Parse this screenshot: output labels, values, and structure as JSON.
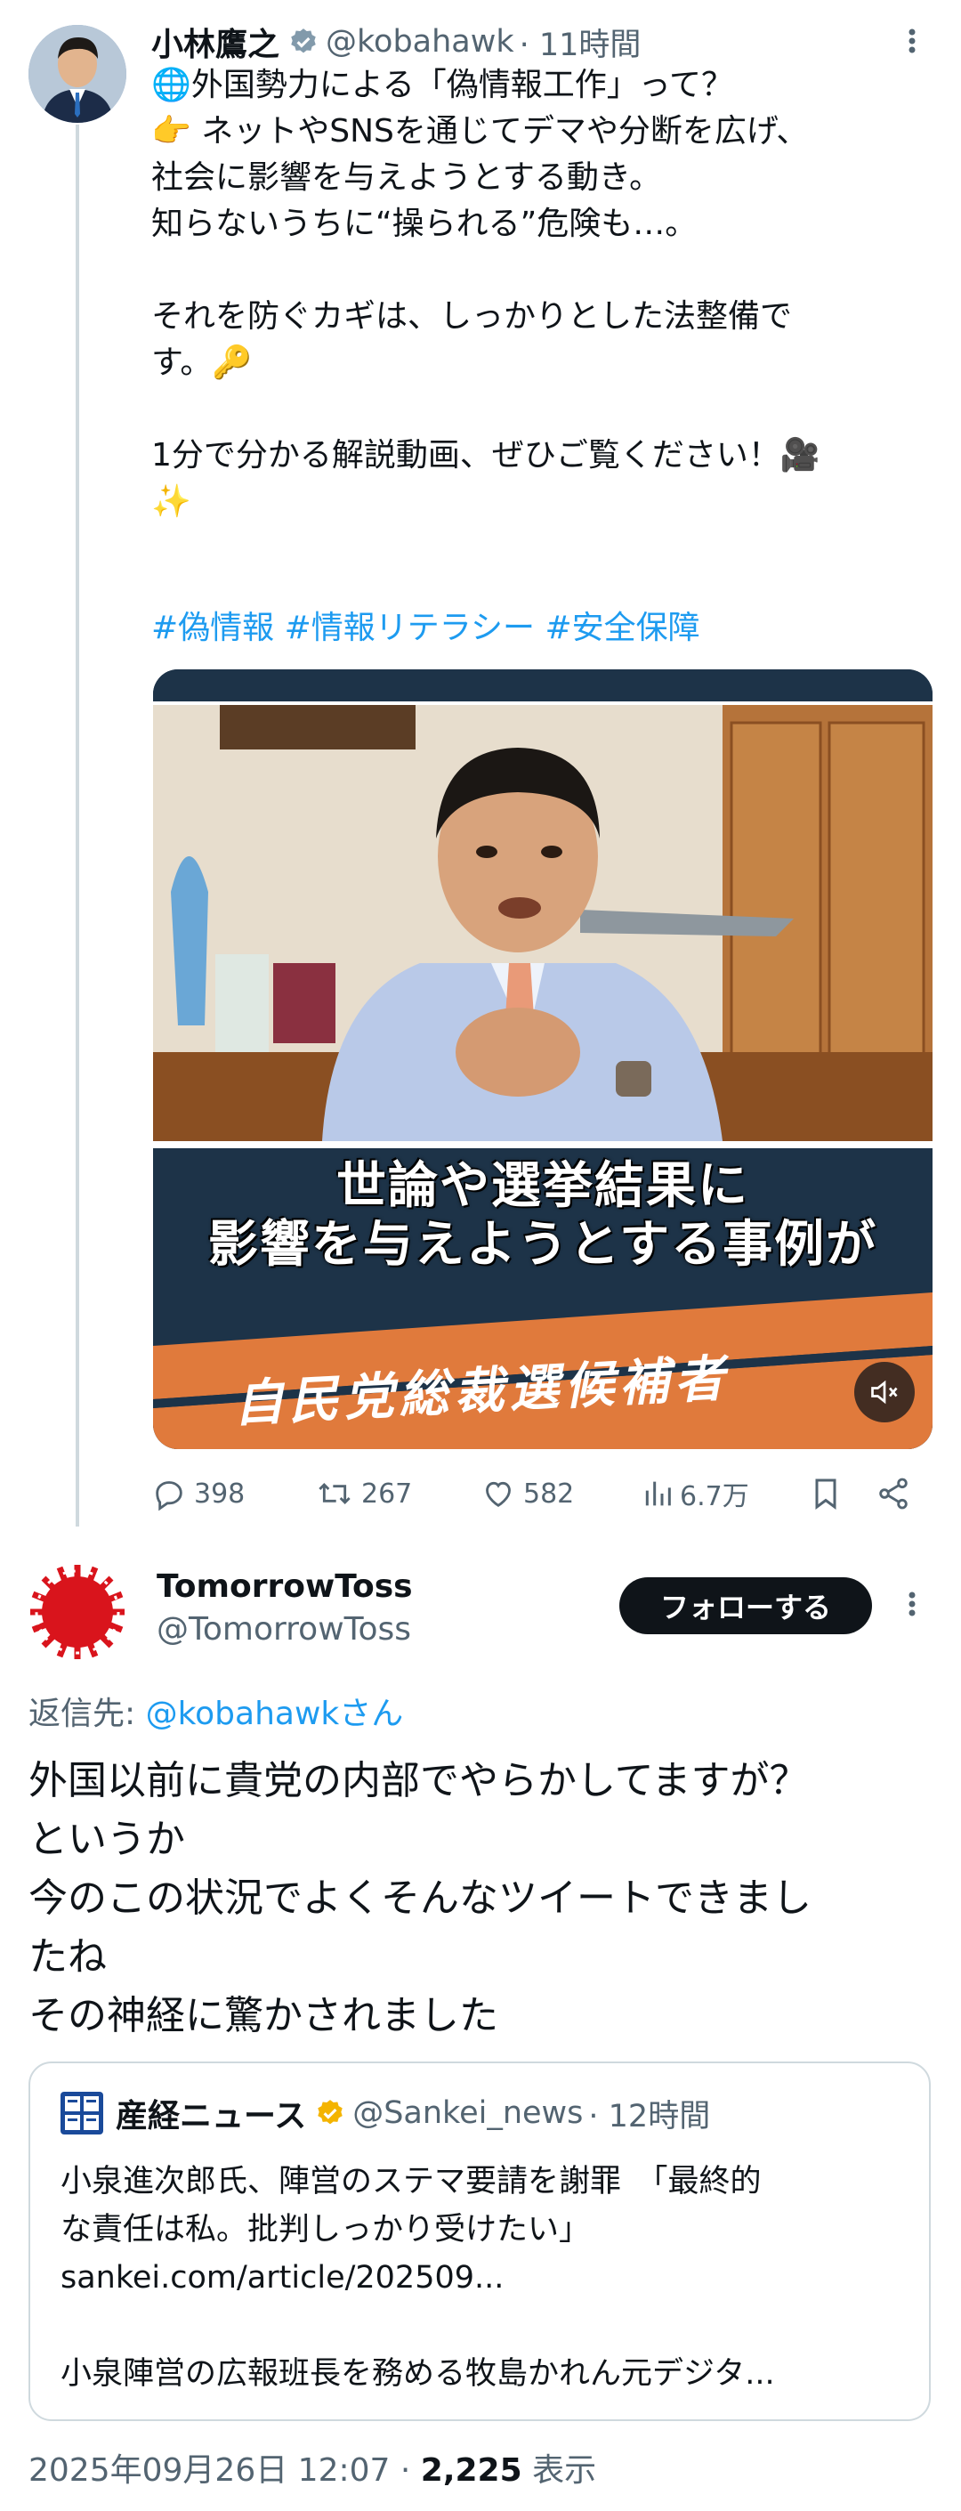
{
  "tweet": {
    "author_name": "小林鷹之",
    "handle": "@kobahawk",
    "time_ago": "· 11時間",
    "lines": [
      "🌐外国勢力による「偽情報工作」って？",
      "👉 ネットやSNSを通じてデマや分断を広げ、",
      "社会に影響を与えようとする動き。",
      "知らないうちに“操られる”危険も…。",
      "",
      "それを防ぐカギは、しっかりとした法整備で",
      "す。🔑",
      "",
      "1分で分かる解説動画、ぜひご覧ください！🎥",
      "✨"
    ],
    "hashtags": "#偽情報 #情報リテラシー #安全保障",
    "video_caption_line1": "世論や選挙結果に",
    "video_caption_line2": "影響を与えようとする事例が",
    "video_caption_line3": "自民党総裁選候補者",
    "mute_icon": "speaker-muted-icon",
    "actions": {
      "replies": "398",
      "retweets": "267",
      "likes": "582",
      "views": "6.7万"
    }
  },
  "reply": {
    "author_name": "TomorrowToss",
    "handle": "@TomorrowToss",
    "follow_label": "フォローする",
    "reply_to_prefix": "返信先: ",
    "reply_to_handle": "@kobahawkさん",
    "lines": [
      "外国以前に貴党の内部でやらかしてますが？",
      "というか",
      "今のこの状況でよくそんなツイートできまし",
      "たね",
      "その神経に驚かされました"
    ],
    "quote": {
      "author_name": "産経ニュース",
      "handle": "@Sankei_news",
      "time_ago": "· 12時間",
      "line1": "小泉進次郎氏、陣営のステマ要請を謝罪　「最終的",
      "line2": "な責任は私。批判しっかり受けたい」",
      "link": "sankei.com/article/202509...",
      "excerpt": "小泉陣営の広報班長を務める牧島かれん元デジタ..."
    },
    "timestamp": "2025年09月26日 12:07 · ",
    "view_count": "2,225",
    "view_label": " 表示"
  },
  "colors": {
    "link": "#1d9bf0",
    "muted": "#536471",
    "verified": "#f4b400",
    "verified_blue": "#829aab",
    "banner_navy": "#1d3348",
    "banner_orange": "#e07a3c"
  }
}
